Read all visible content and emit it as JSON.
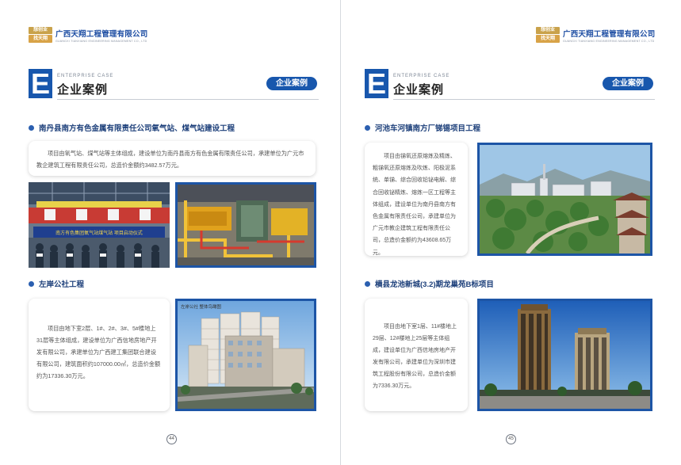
{
  "company": {
    "logo_line1": "想创业",
    "logo_line2": "找天翔",
    "name_cn": "广西天翔工程管理有限公司",
    "name_en": "GUANGXI TIANXIANG ENGINEERING MANAGEMENT CO., LTD"
  },
  "header": {
    "letter": "E",
    "en_title": "ENTERPRISE CASE",
    "cn_title": "企业案例",
    "pill_label": "企业案例"
  },
  "pages": {
    "left": {
      "page_number": "44",
      "projects": [
        {
          "title": "南丹县南方有色金属有限责任公司氧气站、煤气站建设工程",
          "description": "项目由氧气站、煤气站等主体组成，建设单位为南丹县南方有色金属有限责任公司，承建单位为广元市教企建筑工程有限责任公司，总造价金额约3482.57万元。",
          "photo_caption": "南方有色集团氧气站煤气站 项目启动仪式"
        },
        {
          "title": "左岸公社工程",
          "description": "项目由地下室2层、1#、2#、3#、5#楼地上31层等主体组成，建设单位为广西信地房地产开发有限公司，承建单位为广西建工集团联合建设有限公司，建筑面积约107000.00㎡，总造价金额约为17336.30万元。",
          "photo_caption": "左岸公社 整体鸟瞰图"
        }
      ]
    },
    "right": {
      "page_number": "45",
      "projects": [
        {
          "title": "河池车河镇南方厂锑锡项目工程",
          "description": "项目由锑氧还原熔炼及精炼、粗锑氧还原熔炼及吹炼、阳极泥系统、单锑、综合回收铅铋电解、综合回收铋精炼、熔炼一区工程等主体组成，建设单位为南丹县南方有色金属有限责任公司，承建单位为广元市教企建筑工程有限责任公司，总造价金额约为43608.65万元。"
        },
        {
          "title": "横县龙池新城(3.2)期龙巢苑B标项目",
          "description": "项目由地下室1层、11#楼地上29层、12#楼地上25层等主体组成，建设单位为广西信地房地产开发有限公司，承建单位为深圳市建筑工程股份有限公司，总造价金额为7336.30万元。"
        }
      ]
    }
  },
  "colors": {
    "brand_blue": "#1857ad",
    "title_navy": "#1c3f7a",
    "logo_gold": "#d8a347"
  }
}
